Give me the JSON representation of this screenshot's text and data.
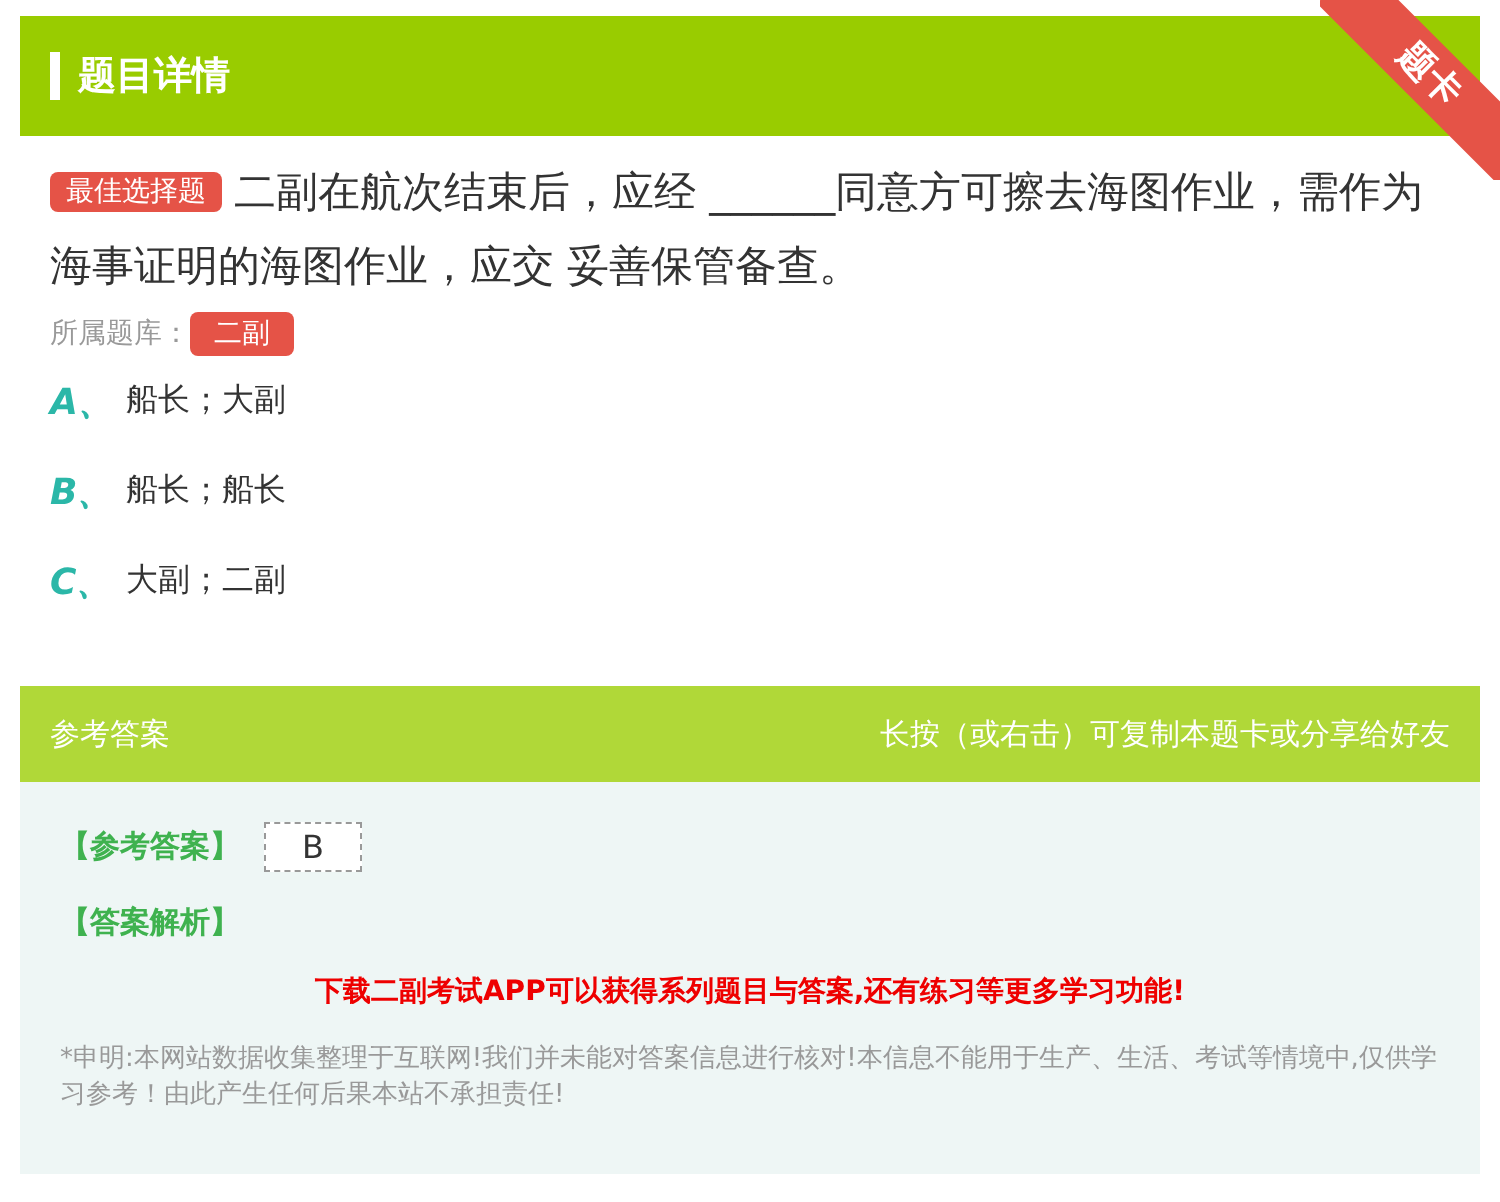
{
  "header": {
    "title": "题目详情",
    "ribbon": "题卡"
  },
  "question": {
    "type_badge": "最佳选择题",
    "text": "二副在航次结束后，应经 ______同意方可擦去海图作业，需作为海事证明的海图作业，应交 妥善保管备查。",
    "bank_label": "所属题库：",
    "bank": "二副"
  },
  "options": [
    {
      "letter": "A、",
      "text": "船长；大副"
    },
    {
      "letter": "B、",
      "text": "船长；船长"
    },
    {
      "letter": "C、",
      "text": "大副；二副"
    }
  ],
  "answer_bar": {
    "title": "参考答案",
    "hint": "长按（或右击）可复制本题卡或分享给好友"
  },
  "answer": {
    "label": "【参考答案】",
    "value": "B",
    "analysis_label": "【答案解析】",
    "promo": "下载二副考试APP可以获得系列题目与答案,还有练习等更多学习功能!",
    "disclaimer": "*申明:本网站数据收集整理于互联网!我们并未能对答案信息进行核对!本信息不能用于生产、生活、考试等情境中,仅供学习参考！由此产生任何后果本站不承担责任!"
  }
}
